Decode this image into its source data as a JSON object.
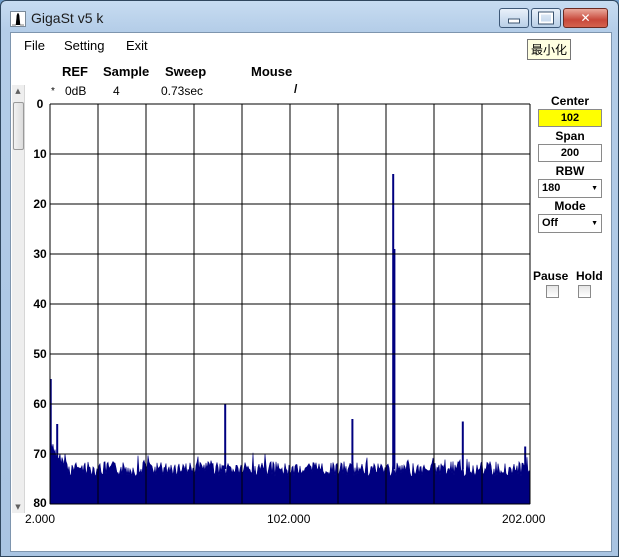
{
  "window": {
    "title": "GigaSt v5 k",
    "tooltip": "最小化"
  },
  "menu": [
    "File",
    "Setting",
    "Exit"
  ],
  "header": {
    "ref_label": "REF",
    "sample_label": "Sample",
    "sweep_label": "Sweep",
    "mouse_label": "Mouse",
    "marker": "*",
    "ref_value": "0dB",
    "sample_value": "4",
    "sweep_value": "0.73sec",
    "mouse_value": "/"
  },
  "panel": {
    "center_label": "Center",
    "center_value": "102",
    "span_label": "Span",
    "span_value": "200",
    "rbw_label": "RBW",
    "rbw_value": "180",
    "mode_label": "Mode",
    "mode_value": "Off",
    "pause_label": "Pause",
    "hold_label": "Hold",
    "pause_checked": false,
    "hold_checked": false
  },
  "colors": {
    "trace": "#000080",
    "center_highlight": "#ffff00",
    "grid": "#000000"
  },
  "chart_data": {
    "type": "area",
    "title": "",
    "xlabel": "",
    "ylabel": "",
    "x_ticks": [
      "2.000",
      "102.000",
      "202.000"
    ],
    "y_ticks": [
      "0",
      "10",
      "20",
      "30",
      "40",
      "50",
      "60",
      "70",
      "80"
    ],
    "xlim": [
      2,
      202
    ],
    "ylim": [
      0,
      80
    ],
    "y_inverted": true,
    "grid": true,
    "noise_floor_db": 73,
    "peaks": [
      {
        "x": 2.3,
        "y": 55
      },
      {
        "x": 5.0,
        "y": 64
      },
      {
        "x": 75.0,
        "y": 60
      },
      {
        "x": 128.0,
        "y": 63
      },
      {
        "x": 145.0,
        "y": 14
      },
      {
        "x": 145.5,
        "y": 29
      },
      {
        "x": 174.0,
        "y": 63.5
      },
      {
        "x": 200.0,
        "y": 68.5
      }
    ]
  }
}
